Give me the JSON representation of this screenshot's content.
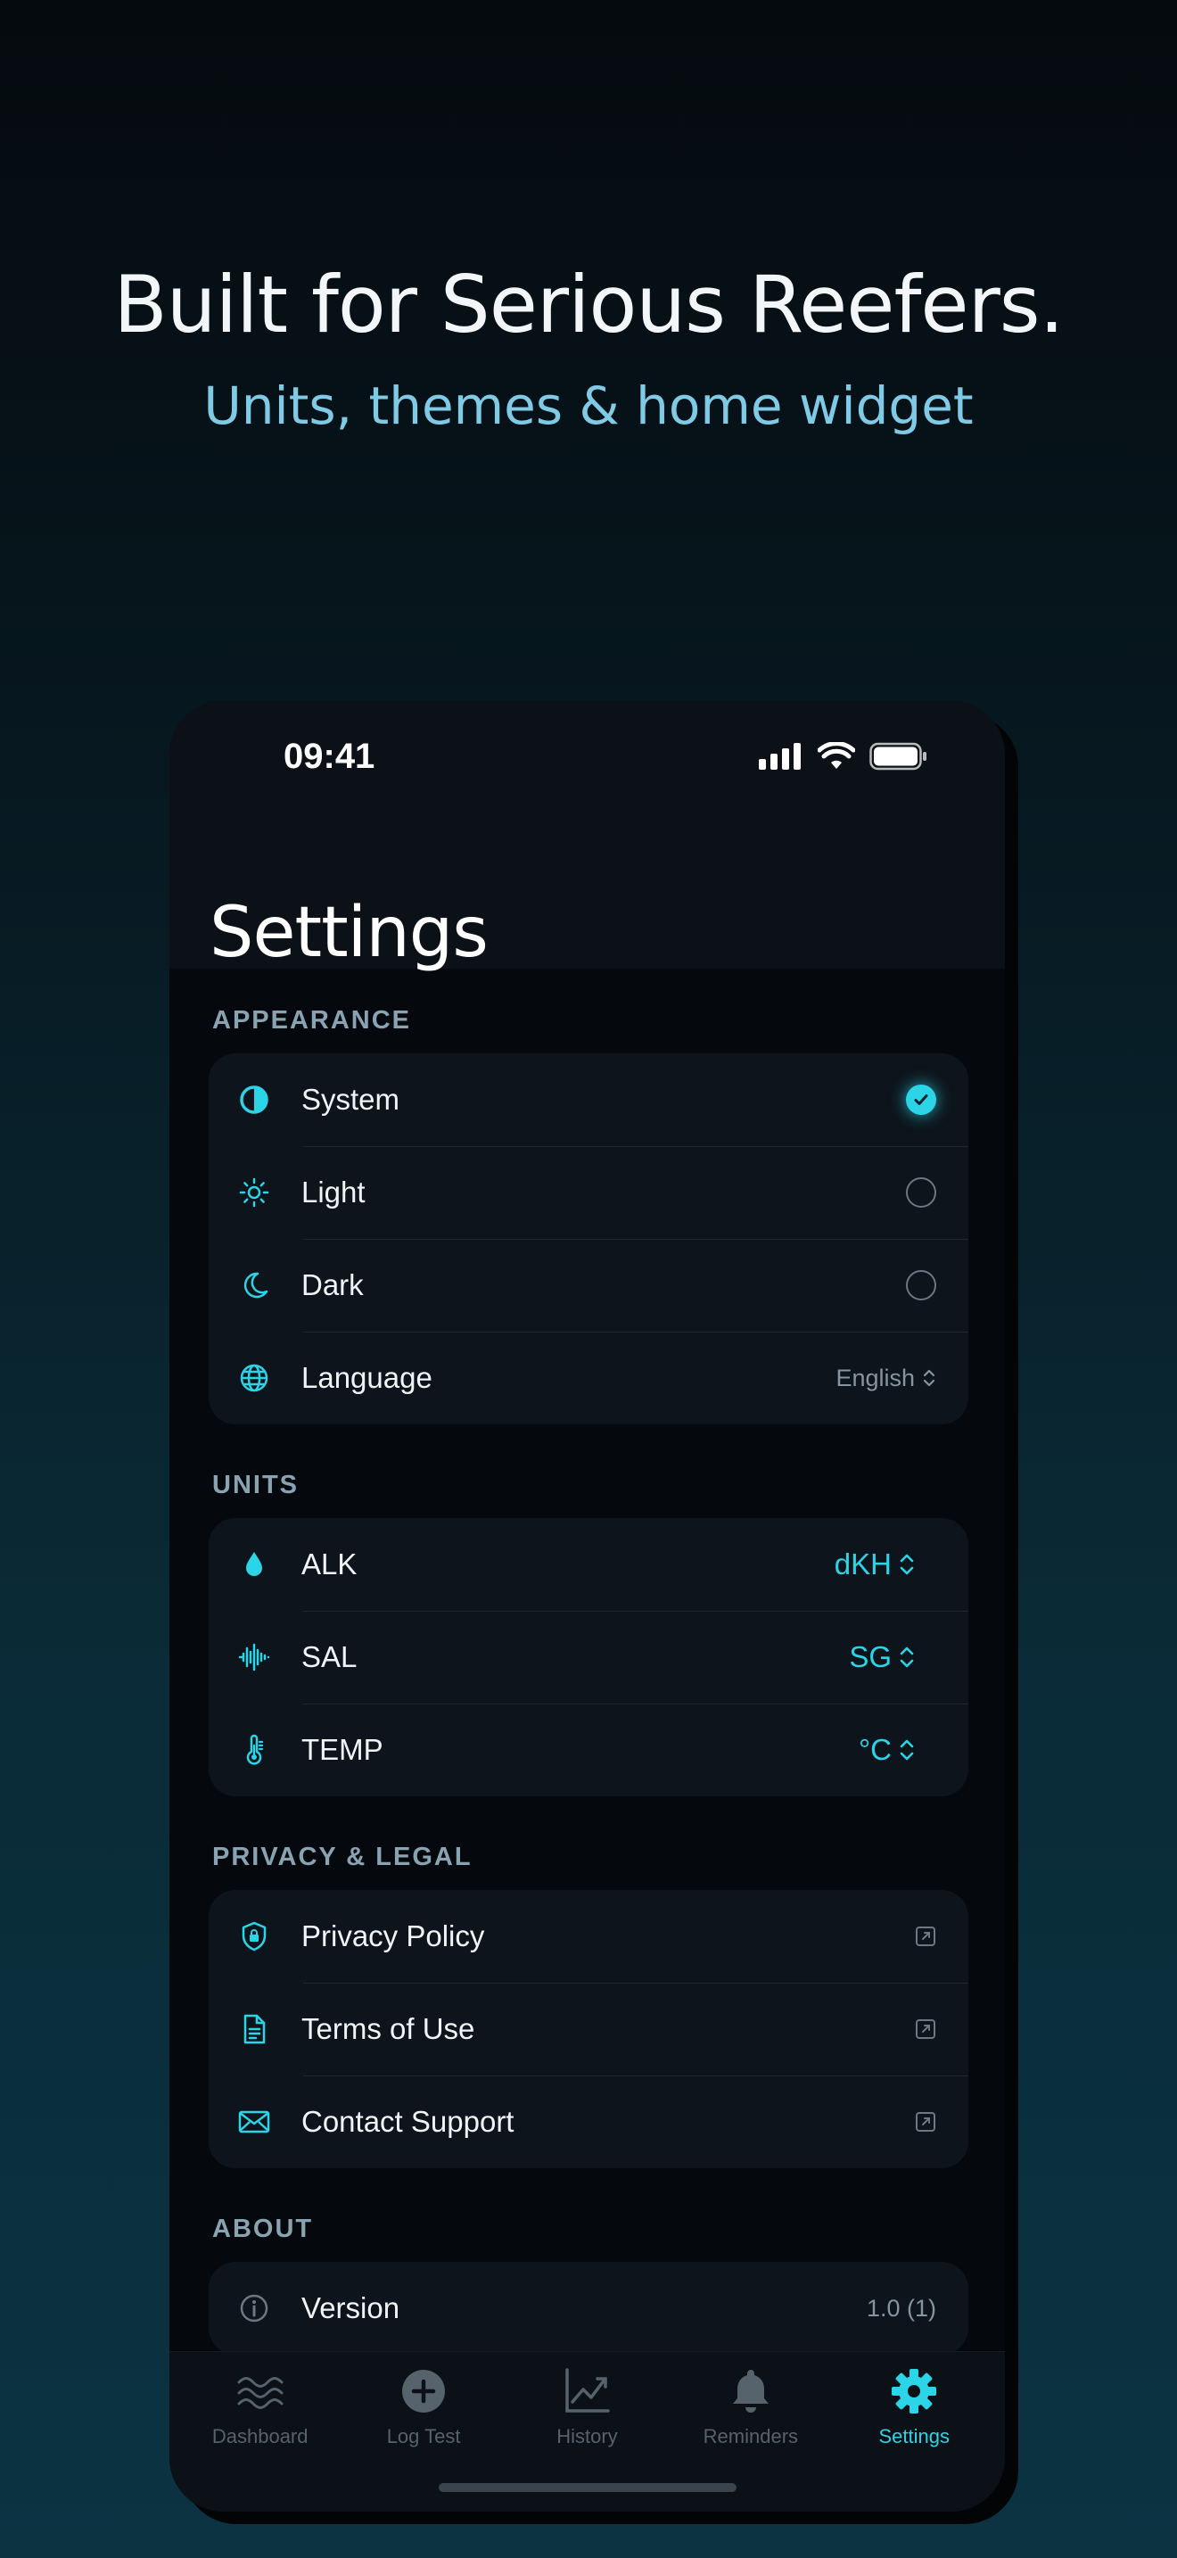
{
  "hero": {
    "headline": "Built for Serious Reefers.",
    "subheadline": "Units, themes & home widget"
  },
  "status_bar": {
    "time": "09:41"
  },
  "page_title": "Settings",
  "sections": {
    "appearance": {
      "label": "APPEARANCE",
      "rows": [
        {
          "label": "System",
          "icon": "half-circle-icon",
          "selected": true
        },
        {
          "label": "Light",
          "icon": "sun-icon",
          "selected": false
        },
        {
          "label": "Dark",
          "icon": "moon-icon",
          "selected": false
        },
        {
          "label": "Language",
          "icon": "globe-icon",
          "value": "English"
        }
      ]
    },
    "units": {
      "label": "UNITS",
      "rows": [
        {
          "label": "ALK",
          "icon": "drop-icon",
          "value": "dKH"
        },
        {
          "label": "SAL",
          "icon": "waveform-icon",
          "value": "SG"
        },
        {
          "label": "TEMP",
          "icon": "thermometer-icon",
          "value": "°C"
        }
      ]
    },
    "privacy": {
      "label": "PRIVACY & LEGAL",
      "rows": [
        {
          "label": "Privacy Policy",
          "icon": "shield-lock-icon"
        },
        {
          "label": "Terms of Use",
          "icon": "document-icon"
        },
        {
          "label": "Contact Support",
          "icon": "envelope-icon"
        }
      ]
    },
    "about": {
      "label": "ABOUT",
      "rows": [
        {
          "label": "Version",
          "icon": "info-icon",
          "value": "1.0 (1)"
        }
      ]
    }
  },
  "tabbar": {
    "items": [
      {
        "label": "Dashboard",
        "icon": "waves-icon"
      },
      {
        "label": "Log Test",
        "icon": "plus-circle-icon"
      },
      {
        "label": "History",
        "icon": "chart-icon"
      },
      {
        "label": "Reminders",
        "icon": "bell-icon"
      },
      {
        "label": "Settings",
        "icon": "gear-icon",
        "active": true
      }
    ]
  },
  "colors": {
    "accent": "#2bd4e6",
    "card": "#0d141b",
    "hero_sub": "#7fcbe6"
  }
}
